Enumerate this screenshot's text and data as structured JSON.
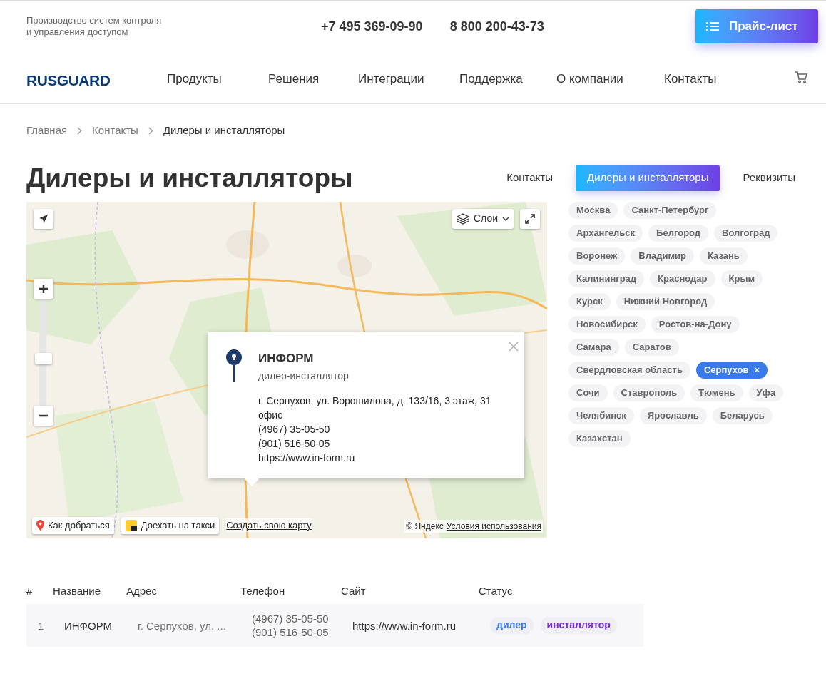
{
  "header": {
    "tagline": [
      "Производство систем контроля",
      "и управления доступом"
    ],
    "phones": [
      "+7 495 369-09-90",
      "8 800 200-43-73"
    ],
    "price_button": "Прайс-лист"
  },
  "nav": {
    "logo": "RUSGUARD",
    "items": [
      "Продукты",
      "Решения",
      "Интеграции",
      "Поддержка",
      "О компании",
      "Контакты"
    ]
  },
  "breadcrumbs": [
    "Главная",
    "Контакты",
    "Дилеры и инсталляторы"
  ],
  "title": "Дилеры и инсталляторы",
  "tabs": [
    {
      "label": "Контакты",
      "selected": false
    },
    {
      "label": "Дилеры и инсталляторы",
      "selected": true
    },
    {
      "label": "Реквизиты",
      "selected": false
    }
  ],
  "cities": [
    {
      "label": "Москва",
      "selected": false
    },
    {
      "label": "Санкт-Петербург",
      "selected": false
    },
    {
      "label": "Архангельск",
      "selected": false
    },
    {
      "label": "Белгород",
      "selected": false
    },
    {
      "label": "Волгоград",
      "selected": false
    },
    {
      "label": "Воронеж",
      "selected": false
    },
    {
      "label": "Владимир",
      "selected": false
    },
    {
      "label": "Казань",
      "selected": false
    },
    {
      "label": "Калининград",
      "selected": false
    },
    {
      "label": "Краснодар",
      "selected": false
    },
    {
      "label": "Крым",
      "selected": false
    },
    {
      "label": "Курск",
      "selected": false
    },
    {
      "label": "Нижний Новгород",
      "selected": false
    },
    {
      "label": "Новосибирск",
      "selected": false
    },
    {
      "label": "Ростов-на-Дону",
      "selected": false
    },
    {
      "label": "Самара",
      "selected": false
    },
    {
      "label": "Саратов",
      "selected": false
    },
    {
      "label": "Свердловская область",
      "selected": false
    },
    {
      "label": "Серпухов",
      "selected": true,
      "remove": "×"
    },
    {
      "label": "Сочи",
      "selected": false
    },
    {
      "label": "Ставрополь",
      "selected": false
    },
    {
      "label": "Тюмень",
      "selected": false
    },
    {
      "label": "Уфа",
      "selected": false
    },
    {
      "label": "Челябинск",
      "selected": false
    },
    {
      "label": "Ярославль",
      "selected": false
    },
    {
      "label": "Беларусь",
      "selected": false
    },
    {
      "label": "Казахстан",
      "selected": false
    }
  ],
  "map": {
    "layers_button": "Слои",
    "route_button": "Как добраться",
    "taxi_button": "Доехать на такси",
    "create_link": "Создать свою карту",
    "copyright": "© Яндекс",
    "terms_link": "Условия использования",
    "popup": {
      "name": "ИНФОРМ",
      "type": "дилер-инсталлятор",
      "address": "г. Серпухов, ул. Ворошилова, д. 133/16, 3 этаж, 31 офис",
      "phones": [
        "(4967) 35-05-50",
        "(901) 516-50-05"
      ],
      "site": "https://www.in-form.ru"
    }
  },
  "table": {
    "columns": [
      "#",
      "Название",
      "Адрес",
      "Телефон",
      "Сайт",
      "Статус"
    ],
    "rows": [
      {
        "number": "1",
        "name": "ИНФОРМ",
        "address": "г. Серпухов, ул. ...",
        "phones": [
          "(4967) 35-05-50",
          "(901) 516-50-05"
        ],
        "site": "https://www.in-form.ru",
        "statuses": [
          {
            "label": "дилер",
            "kind": "dealer"
          },
          {
            "label": "инсталлятор",
            "kind": "installer"
          }
        ]
      }
    ]
  }
}
